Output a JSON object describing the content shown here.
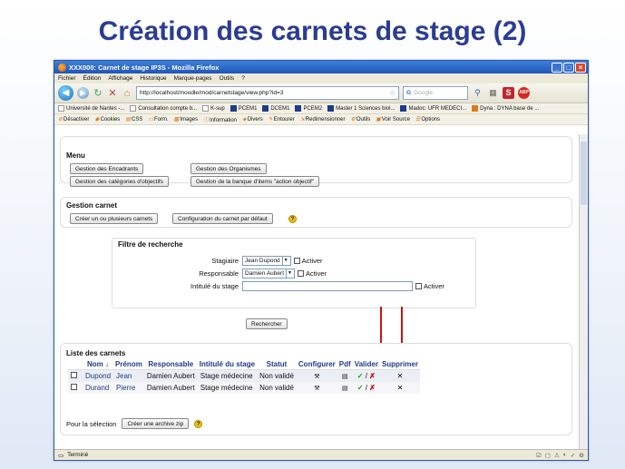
{
  "slide": {
    "title": "Création des carnets de stage (2)"
  },
  "browser": {
    "window_title": "XXX000: Carnet de stage IP3S - Mozilla Firefox",
    "menu": [
      "Fichier",
      "Édition",
      "Affichage",
      "Historique",
      "Marque-pages",
      "Outils",
      "?"
    ],
    "url": "http://localhost/moodle/mod/carnetstage/view.php?id=3",
    "search_placeholder": "Google",
    "bookmarks": [
      "Université de Nantes -...",
      "Consultation compte b...",
      "K-sup",
      "PCEM1",
      "DCEM1",
      "PCEM2",
      "Master 1 Sciences biol...",
      "Madoc: UFR MEDECI...",
      "Dyna : DYNA base de ..."
    ],
    "devbar": [
      "Désactiver",
      "Cookies",
      "CSS",
      "Form.",
      "Images",
      "Information",
      "Divers",
      "Entourer",
      "Redimensionner",
      "Outils",
      "Voir Source",
      "Options"
    ],
    "status": "Terminé"
  },
  "menu_section": {
    "heading": "Menu",
    "buttons": [
      "Gestion des Encadrants",
      "Gestion des Organismes",
      "Gestion des catégories d'objectifs",
      "Gestion de la banque d'items \"action objectif\""
    ]
  },
  "gestion_carnet": {
    "heading": "Gestion carnet",
    "buttons": [
      "Créer un ou plusieurs carnets",
      "Configuration du carnet par défaut"
    ]
  },
  "filter": {
    "heading": "Filtre de recherche",
    "stagiaire_label": "Stagiaire",
    "stagiaire_value": "Jean Dupond",
    "responsable_label": "Responsable",
    "responsable_value": "Damien Aubert",
    "intitule_label": "Intitulé du stage",
    "activer_label": "Activer",
    "search_button": "Rechercher"
  },
  "list": {
    "heading": "Liste des carnets",
    "columns": [
      "Nom ↓",
      "Prénom",
      "Responsable",
      "Intitulé du stage",
      "Statut",
      "Configurer",
      "Pdf",
      "Valider",
      "Supprimer"
    ],
    "rows": [
      {
        "nom": "Dupond",
        "prenom": "Jean",
        "responsable": "Damien Aubert",
        "intitule": "Stage médecine",
        "statut": "Non validé"
      },
      {
        "nom": "Durand",
        "prenom": "Pierre",
        "responsable": "Damien Aubert",
        "intitule": "Stage médecine",
        "statut": "Non validé"
      }
    ],
    "selection_label": "Pour la sélection",
    "zip_button": "Créer une archive zip",
    "valider_ok": "✓",
    "valider_sep": "/",
    "valider_ko": "✗",
    "delete_glyph": "✕"
  }
}
